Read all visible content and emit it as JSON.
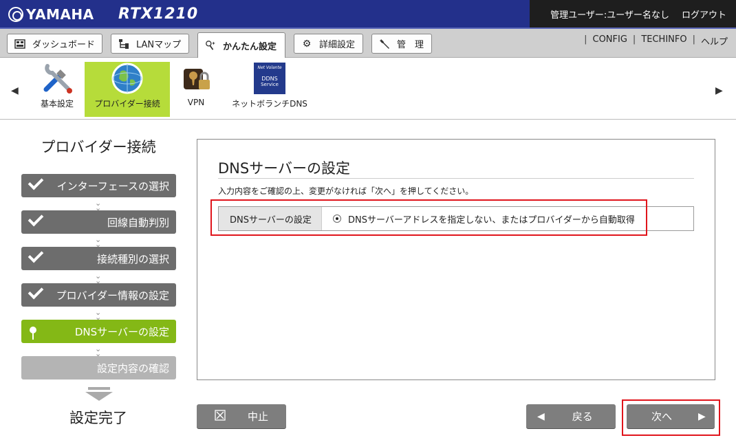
{
  "header": {
    "brand": "YAMAHA",
    "model": "RTX1210",
    "user_status": "管理ユーザー:ユーザー名なし",
    "logout": "ログアウト"
  },
  "menu": {
    "tabs": [
      {
        "label": "ダッシュボード",
        "icon": "dashboard-icon"
      },
      {
        "label": "LANマップ",
        "icon": "lan-map-icon"
      },
      {
        "label": "かんたん設定",
        "icon": "pin-wand-icon"
      },
      {
        "label": "詳細設定",
        "icon": "gear-icon"
      },
      {
        "label": "管　理",
        "icon": "wrench-icon"
      }
    ],
    "links": [
      "CONFIG",
      "TECHINFO",
      "ヘルプ"
    ]
  },
  "submenu": {
    "items": [
      {
        "label": "基本設定",
        "icon": "tools-icon"
      },
      {
        "label": "プロバイダー接続",
        "icon": "globe-icon"
      },
      {
        "label": "VPN",
        "icon": "vpn-lock-icon"
      },
      {
        "label": "ネットボランチDNS",
        "icon": "ddns-icon"
      }
    ],
    "ddns_badge": [
      "Net Volante",
      "DDNS",
      "Service"
    ],
    "active_index": 1
  },
  "wizard": {
    "title": "プロバイダー接続",
    "steps": [
      {
        "label": "インターフェースの選択",
        "state": "done"
      },
      {
        "label": "回線自動判別",
        "state": "done"
      },
      {
        "label": "接続種別の選択",
        "state": "done"
      },
      {
        "label": "プロバイダー情報の設定",
        "state": "done"
      },
      {
        "label": "DNSサーバーの設定",
        "state": "current"
      },
      {
        "label": "設定内容の確認",
        "state": "pending"
      }
    ],
    "final": "設定完了"
  },
  "panel": {
    "title": "DNSサーバーの設定",
    "description": "入力内容をご確認の上、変更がなければ「次へ」を押してください。",
    "field_label": "DNSサーバーの設定",
    "field_value": "DNSサーバーアドレスを指定しない、またはプロバイダーから自動取得"
  },
  "buttons": {
    "cancel": "中止",
    "back": "戻る",
    "next": "次へ"
  },
  "colors": {
    "header_blue": "#23308b",
    "active_green": "#b6dc3a",
    "step_done": "#6d6d6d",
    "step_current": "#84b816",
    "highlight_red": "#e0141b"
  }
}
